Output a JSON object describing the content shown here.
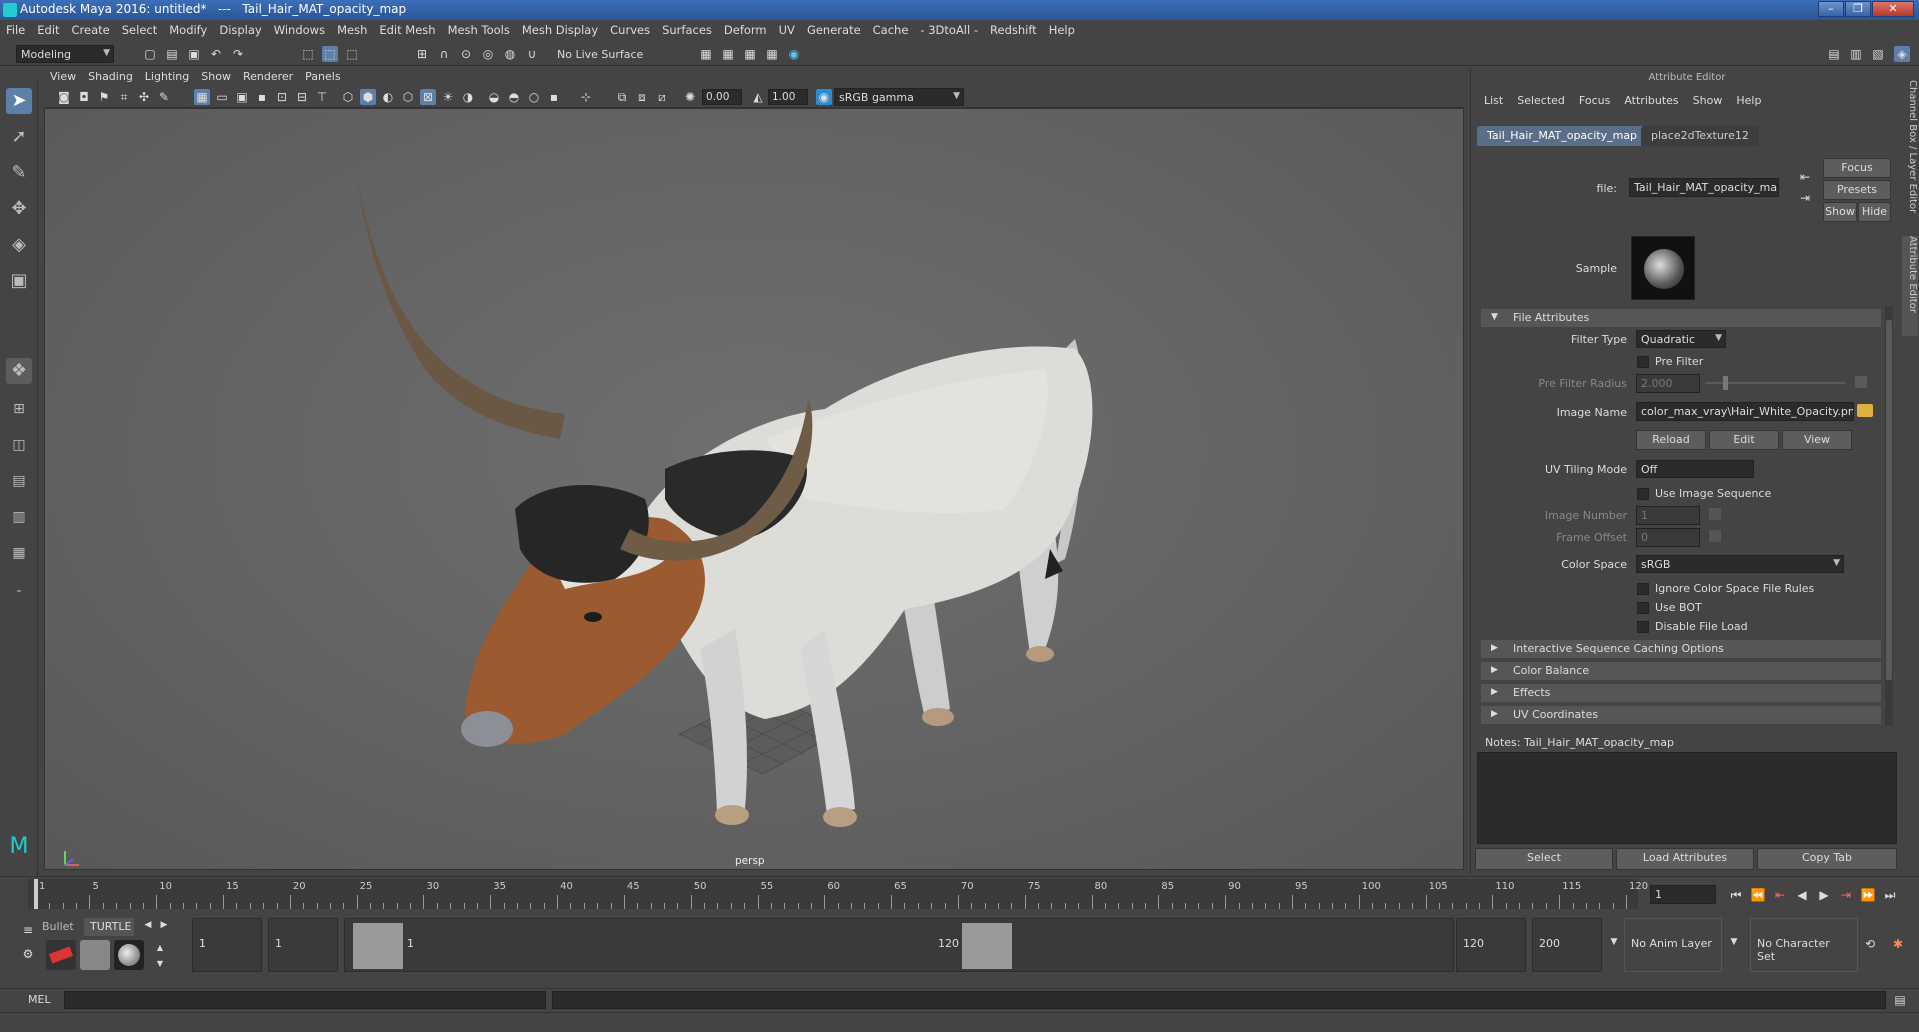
{
  "window": {
    "title": "Autodesk Maya 2016: untitled*   ---   Tail_Hair_MAT_opacity_map",
    "controls": [
      "–",
      "❐",
      "✕"
    ]
  },
  "menubar": [
    "File",
    "Edit",
    "Create",
    "Select",
    "Modify",
    "Display",
    "Windows",
    "Mesh",
    "Edit Mesh",
    "Mesh Tools",
    "Mesh Display",
    "Curves",
    "Surfaces",
    "Deform",
    "UV",
    "Generate",
    "Cache",
    "- 3DtoAll -",
    "Redshift",
    "Help"
  ],
  "statusline": {
    "menuset": "Modeling",
    "live_surface": "No Live Surface"
  },
  "panel": {
    "menus": [
      "View",
      "Shading",
      "Lighting",
      "Show",
      "Renderer",
      "Panels"
    ],
    "exposure": "0.00",
    "gamma": "1.00",
    "color_space": "sRGB gamma",
    "camera_label": "persp"
  },
  "attribute_editor": {
    "header": "Attribute Editor",
    "menus": [
      "List",
      "Selected",
      "Focus",
      "Attributes",
      "Show",
      "Help"
    ],
    "tabs": [
      "Tail_Hair_MAT_opacity_map",
      "place2dTexture12"
    ],
    "file_label": "file:",
    "file_value": "Tail_Hair_MAT_opacity_map",
    "buttons": {
      "focus": "Focus",
      "presets": "Presets",
      "show": "Show",
      "hide": "Hide"
    },
    "sample_label": "Sample",
    "file_attributes": {
      "section": "File Attributes",
      "filter_type_label": "Filter Type",
      "filter_type": "Quadratic",
      "pre_filter": "Pre Filter",
      "pre_filter_radius_label": "Pre Filter Radius",
      "pre_filter_radius": "2.000",
      "image_name_label": "Image Name",
      "image_name": "color_max_vray\\Hair_White_Opacity.png",
      "reload": "Reload",
      "edit": "Edit",
      "view": "View",
      "uv_tiling_label": "UV Tiling Mode",
      "uv_tiling": "Off",
      "use_image_sequence": "Use Image Sequence",
      "image_number_label": "Image Number",
      "image_number": "1",
      "frame_offset_label": "Frame Offset",
      "frame_offset": "0",
      "color_space_label": "Color Space",
      "color_space": "sRGB",
      "ignore_cs": "Ignore Color Space File Rules",
      "use_bot": "Use BOT",
      "disable_file_load": "Disable File Load"
    },
    "collapsed_sections": [
      "Interactive Sequence Caching Options",
      "Color Balance",
      "Effects",
      "UV Coordinates"
    ],
    "notes_label": "Notes:  Tail_Hair_MAT_opacity_map",
    "bottom_buttons": [
      "Select",
      "Load Attributes",
      "Copy Tab"
    ],
    "side_tabs": [
      "Channel Box / Layer Editor",
      "Attribute Editor"
    ]
  },
  "timeline": {
    "tick_labels": [
      "1",
      "5",
      "10",
      "15",
      "20",
      "25",
      "30",
      "35",
      "40",
      "45",
      "50",
      "55",
      "60",
      "65",
      "70",
      "75",
      "80",
      "85",
      "90",
      "95",
      "100",
      "105",
      "110",
      "115",
      "120"
    ],
    "current_frame": "1"
  },
  "range": {
    "shelf_tabs": [
      "Bullet",
      "TURTLE"
    ],
    "start": "1",
    "start2": "1",
    "slider_start": "1",
    "slider_end": "120",
    "end": "120",
    "end2": "200",
    "anim_layer": "No Anim Layer",
    "character_set": "No Character Set"
  },
  "commandline": {
    "label": "MEL"
  }
}
